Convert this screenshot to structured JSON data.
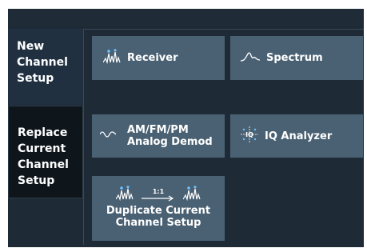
{
  "rail": {
    "new_channel": "New\nChannel\nSetup",
    "replace_channel": "Replace\nCurrent\nChannel\nSetup"
  },
  "tiles": {
    "receiver": {
      "label": "Receiver",
      "icon": "receiver-icon"
    },
    "spectrum": {
      "label": "Spectrum",
      "icon": "spectrum-icon"
    },
    "analog_demod": {
      "line1": "AM/FM/PM",
      "line2": "Analog Demod",
      "icon": "analog-demod-icon"
    },
    "iq_analyzer": {
      "label": "IQ Analyzer",
      "icon": "iq-analyzer-icon"
    },
    "duplicate": {
      "line1": "Duplicate Current",
      "line2": "Channel Setup",
      "arrow_label": "1:1",
      "icon": "duplicate-icon"
    }
  },
  "colors": {
    "tile": "#4a6173",
    "background": "#1e2b37",
    "replace_selected": "#0e161c",
    "accent_marker": "#6ec1ff"
  }
}
